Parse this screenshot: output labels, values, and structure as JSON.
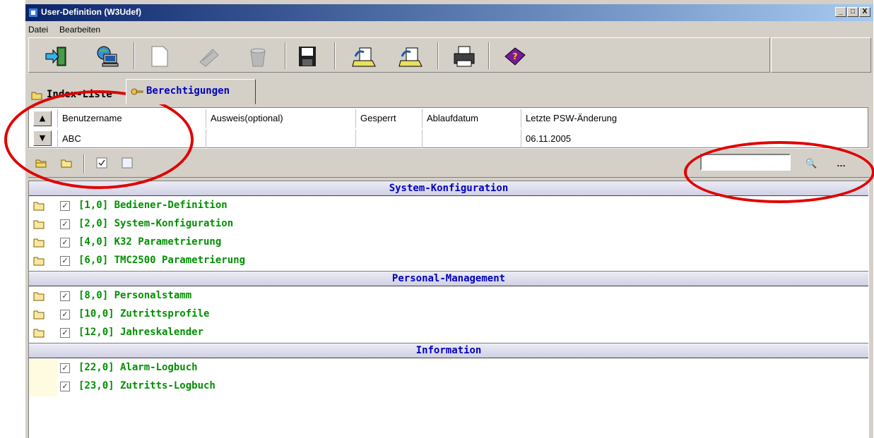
{
  "window": {
    "title": "User-Definition (W3Udef)",
    "buttons": [
      "_",
      "□",
      "X"
    ]
  },
  "menu": [
    "Datei",
    "Bearbeiten"
  ],
  "toolbar": {
    "buttons": [
      "exit-icon",
      "network-computer-icon",
      "new-document-icon",
      "edit-icon",
      "delete-icon",
      "save-icon",
      "import-icon",
      "export-icon",
      "print-icon",
      "help-book-icon"
    ]
  },
  "tabs": [
    {
      "label": "Index-Liste"
    },
    {
      "label": "Berechtigungen",
      "active": true
    }
  ],
  "user_grid": {
    "columns": [
      "Benutzername",
      "Ausweis(optional)",
      "Gesperrt",
      "Ablaufdatum",
      "Letzte PSW-Änderung"
    ],
    "row": [
      "ABC",
      "",
      "",
      "",
      "06.11.2005"
    ]
  },
  "search": {
    "value": "",
    "find_label": "🔍",
    "find_more_label": "…"
  },
  "sections": [
    {
      "title": "System-Konfiguration",
      "items": [
        "[1,0] Bediener-Definition",
        "[2,0] System-Konfiguration",
        "[4,0] K32 Parametrierung",
        "[6,0] TMC2500 Parametrierung"
      ]
    },
    {
      "title": "Personal-Management",
      "items": [
        "[8,0] Personalstamm",
        "[10,0] Zutrittsprofile",
        "[12,0] Jahreskalender"
      ]
    },
    {
      "title": "Information",
      "items": [
        "[22,0] Alarm-Logbuch",
        "[23,0] Zutritts-Logbuch"
      ]
    }
  ],
  "check_mark": "✓",
  "colors": {
    "titlebar": "#0a246a",
    "section_text": "#0000c0",
    "item_text": "#009000",
    "annotation": "#e00000"
  }
}
